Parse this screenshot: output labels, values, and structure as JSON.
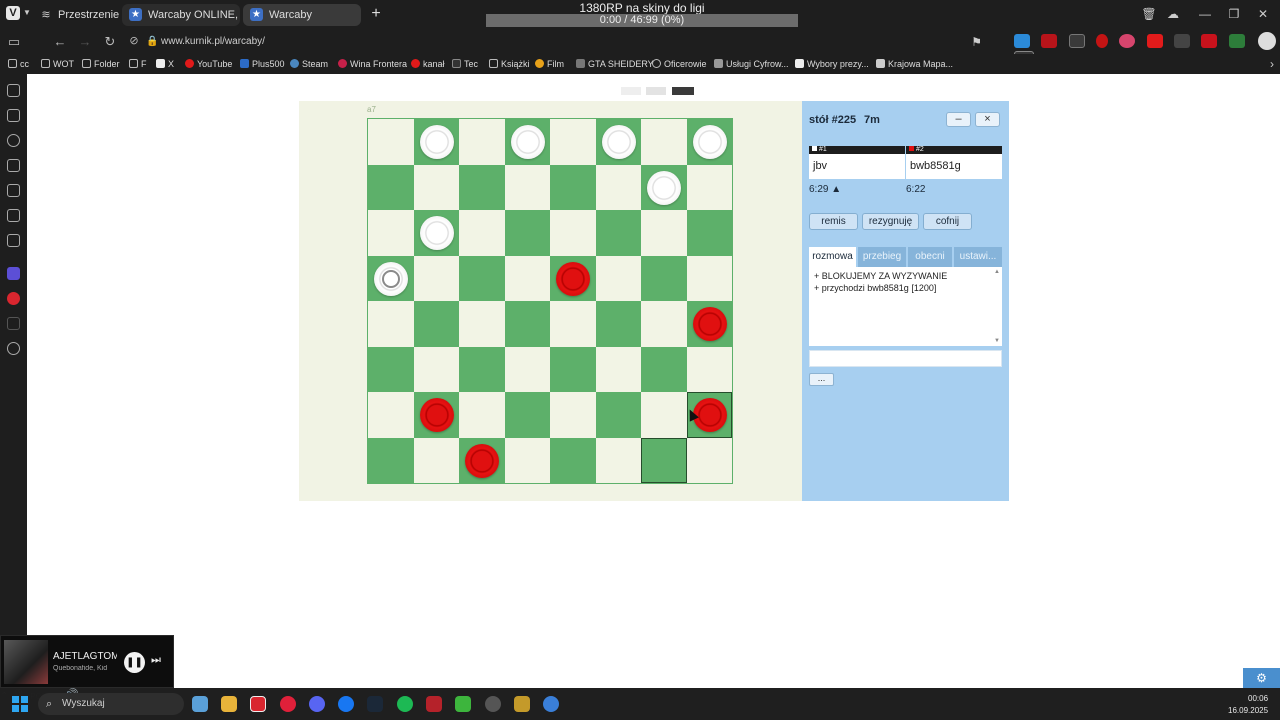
{
  "browser": {
    "spaces_label": "Przestrzenie",
    "tabs": [
      {
        "title": "Warcaby ONLINE, zagraj - k",
        "icon": "star-icon"
      },
      {
        "title": "Warcaby",
        "icon": "star-icon"
      }
    ],
    "url": "www.kurnik.pl/warcaby/",
    "media_title": "1380RP na skiny do ligi",
    "media_progress": "0:00 / 46:99 (0%)",
    "bookmarks": [
      "cc",
      "WOT",
      "Folder",
      "F",
      "X",
      "YouTube",
      "Plus500",
      "Steam",
      "Wina Frontera",
      "kanał",
      "Tec",
      "Książki",
      "Film",
      "GTA SHEIDERY",
      "Oficerowie",
      "Usługi Cyfrow...",
      "Wybory prezy...",
      "Krajowa Mapa..."
    ]
  },
  "game": {
    "coord_label": "a7",
    "board": [
      [
        "",
        "w",
        "",
        "w",
        "",
        "w",
        "",
        "w"
      ],
      [
        "",
        "",
        "",
        "",
        "",
        "",
        "w",
        ""
      ],
      [
        "",
        "w",
        "",
        "",
        "",
        "",
        "",
        ""
      ],
      [
        "wk",
        "",
        "",
        "",
        "r",
        "",
        "",
        ""
      ],
      [
        "",
        "",
        "",
        "",
        "",
        "",
        "",
        "r"
      ],
      [
        "",
        "",
        "",
        "",
        "",
        "",
        "",
        ""
      ],
      [
        "",
        "r",
        "",
        "",
        "",
        "",
        "",
        "r"
      ],
      [
        "",
        "",
        "r",
        "",
        "",
        "",
        "",
        ""
      ]
    ],
    "selected_squares": [
      [
        6,
        7
      ],
      [
        7,
        6
      ]
    ]
  },
  "panel": {
    "table_title": "stół #225",
    "table_time": "7m",
    "minimize_label": "–",
    "close_label": "×",
    "players": [
      {
        "seat": "#1",
        "name": "jbv",
        "clock": "6:29 ▲",
        "marker_color": "#ffffff"
      },
      {
        "seat": "#2",
        "name": "bwb8581g",
        "clock": "6:22",
        "marker_color": "#e01010"
      }
    ],
    "actions": [
      "remis",
      "rezygnuję",
      "cofnij"
    ],
    "tabs": [
      "rozmowa",
      "przebieg",
      "obecni",
      "ustawi..."
    ],
    "chat": [
      "+ BLOKUJEMY ZA WYZYWANIE",
      "+ przychodzi bwb8581g [1200]"
    ],
    "more_label": "..."
  },
  "media_widget": {
    "title": "AJETLAGTOM",
    "artist": "Quebonafide, Kid"
  },
  "taskbar": {
    "search_placeholder": "Wyszukaj",
    "lang": "POL",
    "time": "00:06",
    "date": "16.09.2025"
  },
  "colors": {
    "board_dark": "#5db06a",
    "board_light": "#f2f4e5",
    "panel_bg": "#a7cff0",
    "accent": "#4a8fce"
  }
}
